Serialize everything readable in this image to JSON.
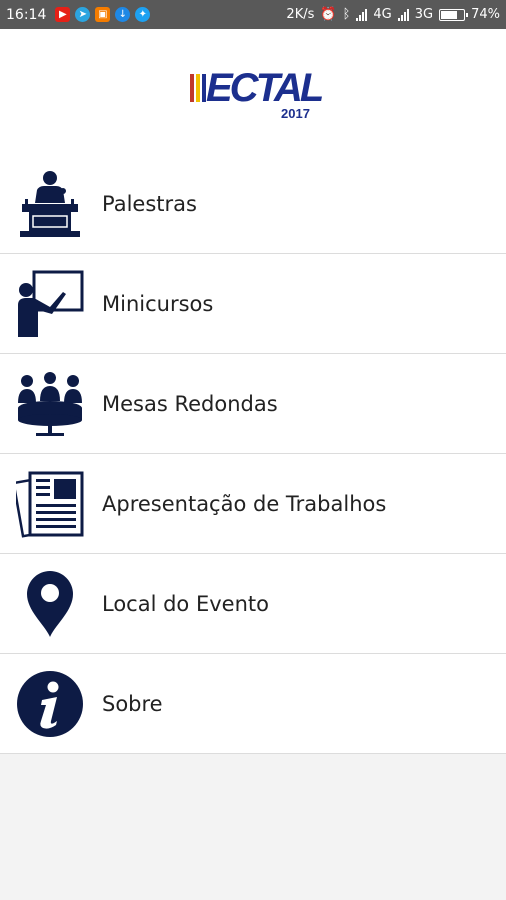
{
  "status_bar": {
    "time": "16:14",
    "network_speed": "2K/s",
    "network_type_1": "4G",
    "network_type_2": "3G",
    "battery": "74%",
    "battery_level": 0.74,
    "notifications": [
      "youtube-icon",
      "telegram-icon",
      "app-icon",
      "download-icon",
      "twitter-icon"
    ]
  },
  "header": {
    "logo_text": "ECTAL",
    "logo_year": "2017",
    "logo_colors": [
      "#c0392b",
      "#f2c200",
      "#1c2f8e"
    ]
  },
  "menu": {
    "items": [
      {
        "label": "Palestras",
        "icon": "podium-speaker-icon"
      },
      {
        "label": "Minicursos",
        "icon": "teacher-board-icon"
      },
      {
        "label": "Mesas Redondas",
        "icon": "round-table-icon"
      },
      {
        "label": "Apresentação de Trabalhos",
        "icon": "documents-icon"
      },
      {
        "label": "Local do Evento",
        "icon": "location-pin-icon"
      },
      {
        "label": "Sobre",
        "icon": "info-icon"
      }
    ]
  },
  "colors": {
    "icon": "#0d1b45",
    "status_bar": "#595959",
    "background": "#f3f3f3"
  }
}
